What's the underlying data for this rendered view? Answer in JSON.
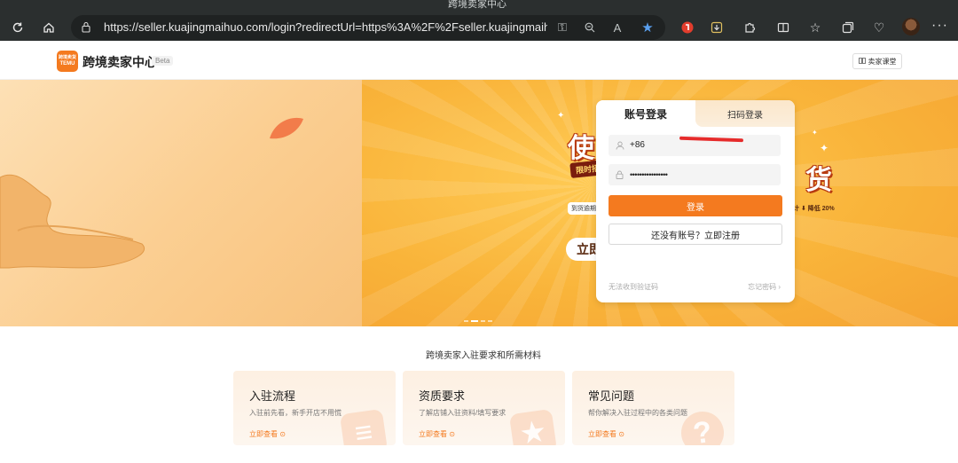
{
  "browser": {
    "tab_title": "跨境卖家中心",
    "url": "https://seller.kuajingmaihuo.com/login?redirectUrl=https%3A%2F%2Fseller.kuajingmaihuo.com%2F",
    "read_aloud": "A",
    "icons": [
      "refresh-icon",
      "home-icon",
      "lock-icon",
      "key-icon",
      "zoom-icon",
      "read-aloud-icon",
      "favorite-star-icon",
      "extension-red-icon",
      "download-icon",
      "puzzle-icon",
      "split-screen-icon",
      "favorites-icon",
      "collections-icon",
      "heart-icon",
      "profile-avatar",
      "more-icon"
    ]
  },
  "header": {
    "logo_text_top": "跨境卖货",
    "logo_text_bottom": "TEMU",
    "title": "跨境卖家中心",
    "badge": "Beta",
    "classroom": "卖家课堂"
  },
  "banner": {
    "promo_tag": "限时招",
    "promo_chars_left": "使",
    "promo_chars_right": "货",
    "promo_pill_left": "到货逾期",
    "promo_pill_right": "计 ⬇ 降低 20%",
    "promo_button": "立即",
    "colors": {
      "left_bg": "#fbcf93",
      "right_bg": "#f9b43a",
      "brand": "#f47a1f"
    }
  },
  "login": {
    "tabs": [
      "账号登录",
      "扫码登录"
    ],
    "phone_prefix": "+86",
    "password_mask": "••••••••••••••••",
    "login_button": "登录",
    "register_button": "还没有账号？立即注册",
    "no_code": "无法收到验证码",
    "forgot": "忘记密码"
  },
  "section": {
    "title": "跨境卖家入驻要求和所需材料",
    "cards": [
      {
        "title": "入驻流程",
        "desc": "入驻前先看，新手开店不用慌",
        "link": "立即查看"
      },
      {
        "title": "资质要求",
        "desc": "了解店铺入驻资料/填写要求",
        "link": "立即查看"
      },
      {
        "title": "常见问题",
        "desc": "帮你解决入驻过程中的各类问题",
        "link": "立即查看"
      }
    ]
  }
}
